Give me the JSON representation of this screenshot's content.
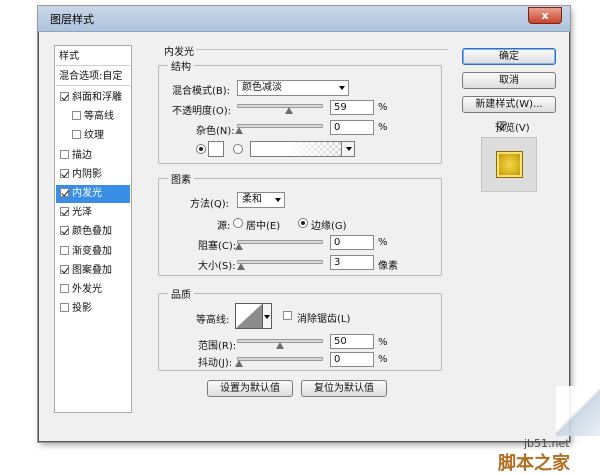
{
  "window": {
    "title": "图层样式",
    "close_label": "x"
  },
  "left_panel": {
    "header": "样式",
    "blend_options": "混合选项:自定",
    "items": [
      {
        "label": "斜面和浮雕",
        "checked": true,
        "indent": 0
      },
      {
        "label": "等高线",
        "checked": false,
        "indent": 1
      },
      {
        "label": "纹理",
        "checked": false,
        "indent": 1
      },
      {
        "label": "描边",
        "checked": false,
        "indent": 0
      },
      {
        "label": "内阴影",
        "checked": true,
        "indent": 0
      },
      {
        "label": "内发光",
        "checked": true,
        "indent": 0,
        "selected": true
      },
      {
        "label": "光泽",
        "checked": true,
        "indent": 0
      },
      {
        "label": "颜色叠加",
        "checked": true,
        "indent": 0
      },
      {
        "label": "渐变叠加",
        "checked": false,
        "indent": 0
      },
      {
        "label": "图案叠加",
        "checked": true,
        "indent": 0
      },
      {
        "label": "外发光",
        "checked": false,
        "indent": 0
      },
      {
        "label": "投影",
        "checked": false,
        "indent": 0
      }
    ]
  },
  "inner_glow": {
    "section_title": "内发光",
    "structure": {
      "title": "结构",
      "blend_mode_label": "混合模式(B):",
      "blend_mode_value": "颜色减淡",
      "opacity_label": "不透明度(O):",
      "opacity_value": "59",
      "opacity_unit": "%",
      "noise_label": "杂色(N):",
      "noise_value": "0",
      "noise_unit": "%"
    },
    "elements": {
      "title": "图素",
      "technique_label": "方法(Q):",
      "technique_value": "柔和",
      "source_label": "源:",
      "source_center": "居中(E)",
      "source_edge": "边缘(G)",
      "choke_label": "阻塞(C):",
      "choke_value": "0",
      "choke_unit": "%",
      "size_label": "大小(S):",
      "size_value": "3",
      "size_unit": "像素"
    },
    "quality": {
      "title": "品质",
      "contour_label": "等高线:",
      "anti_alias_label": "消除锯齿(L)",
      "range_label": "范围(R):",
      "range_value": "50",
      "range_unit": "%",
      "jitter_label": "抖动(J):",
      "jitter_value": "0",
      "jitter_unit": "%"
    },
    "make_default": "设置为默认值",
    "reset_default": "复位为默认值"
  },
  "right_panel": {
    "ok": "确定",
    "cancel": "取消",
    "new_style": "新建样式(W)...",
    "preview_label": "预览(V)"
  },
  "colors": {
    "accent": "#3a8ee6",
    "preview_swatch": "#d8b21b"
  },
  "watermark": {
    "site": "jb51.net",
    "brand": "脚本之家"
  }
}
